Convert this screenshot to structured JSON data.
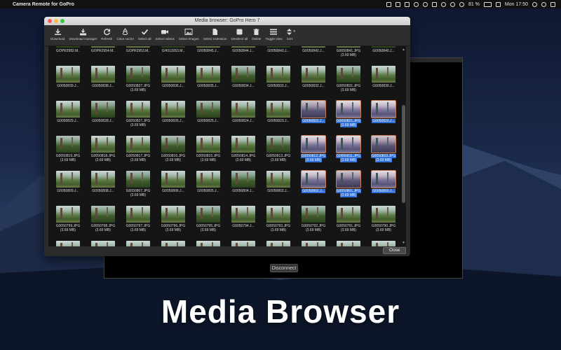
{
  "menubar": {
    "app_name": "Camera Remote for GoPro",
    "battery": "81 %",
    "clock": "Mon 17:50"
  },
  "media_window": {
    "title": "Media browser: GoPro Hero 7",
    "close_label": "Close"
  },
  "toolbar": [
    {
      "label": "Download",
      "icon": "download-icon"
    },
    {
      "label": "Download manager",
      "icon": "download-manager-icon"
    },
    {
      "label": "Refresh",
      "icon": "refresh-icon"
    },
    {
      "label": "Clear cache",
      "icon": "recycle-icon"
    },
    {
      "label": "Select all",
      "icon": "checkmark-icon"
    },
    {
      "label": "Select videos",
      "icon": "video-camera-icon"
    },
    {
      "label": "Select images",
      "icon": "image-icon"
    },
    {
      "label": "Select extension",
      "icon": "file-icon"
    },
    {
      "label": "Deselect all",
      "icon": "square-icon"
    },
    {
      "label": "Delete",
      "icon": "trash-icon"
    },
    {
      "label": "Toggle view",
      "icon": "list-icon"
    },
    {
      "label": "Sort",
      "icon": "sort-icon"
    }
  ],
  "rows": [
    [
      "GOPR2982.M..",
      "GOPR2954.M..",
      "GOPR2953.M..",
      "GH013053.M..",
      "G0050845.J...",
      "G0050844.J...",
      "G0050843.J...",
      "G0050842.J...",
      "G0050841.JPG|(3.69 MB)",
      "G0050840.J..."
    ],
    [
      "G0050839.J...",
      "G0050838.J...",
      "G0050837.JPG|(3.69 MB)",
      "G0050836.J...",
      "G0050835.J...",
      "G0050834.J...",
      "G0050833.J...",
      "G0050832.J...",
      "G0050831.JPG|(3.69 MB)",
      "G0050830.J..."
    ],
    [
      "G0050829.J...",
      "G0050828.J...",
      "G0050827.JPG|(3.69 MB)",
      "G0050826.J...",
      "G0050825.J...",
      "G0050824.J...",
      "G0050823.J...",
      "G0050822.J...",
      "G0050821.JPG|(3.69 MB)",
      "G0050820.J..."
    ],
    [
      "G0050819.JPG|(3.69 MB)",
      "G0050818.JPG|(3.69 MB)",
      "G0050817.JPG|(3.69 MB)",
      "G0050816.JPG|(3.69 MB)",
      "G0050815.JPG|(3.69 MB)",
      "G0050814.JPG|(3.69 MB)",
      "G0050813.JPG|(3.69 MB)",
      "G0050812.JPG|(3.69 MB)",
      "G0050811.JPG|(3.69 MB)",
      "G0050810.JPG|(3.69 MB)"
    ],
    [
      "G0050809.J...",
      "G0050808.J...",
      "G0050807.JPG|(3.69 MB)",
      "G0050806.J...",
      "G0050805.J...",
      "G0050804.J...",
      "G0050803.J...",
      "G0050802.J...",
      "G0050801.JPG|(3.69 MB)",
      "G0050800.J..."
    ],
    [
      "G0050799.JPG|(3.69 MB)",
      "G0050798.JPG|(3.69 MB)",
      "G0050797.JPG|(3.69 MB)",
      "G0050796.JPG|(3.69 MB)",
      "G0050795.JPG|(3.69 MB)",
      "G0050794.J...",
      "G0050793.JPG|(3.69 MB)",
      "G0050792.JPG|(3.69 MB)",
      "G0050791.JPG|(3.69 MB)",
      "G0050790.JPG|(3.69 MB)"
    ]
  ],
  "selected": [
    "G0050822.J...",
    "G0050821.JPG|(3.69 MB)",
    "G0050820.J...",
    "G0050812.JPG|(3.69 MB)",
    "G0050811.JPG|(3.69 MB)",
    "G0050810.JPG|(3.69 MB)",
    "G0050802.J...",
    "G0050801.JPG|(3.69 MB)",
    "G0050800.J..."
  ],
  "back_window": {
    "disconnect_label": "Disconnect"
  },
  "caption": "Media Browser",
  "colors": {
    "selection": "#2f6fd6",
    "window_bg": "#2b2b2b",
    "grid_bg": "#151515"
  }
}
